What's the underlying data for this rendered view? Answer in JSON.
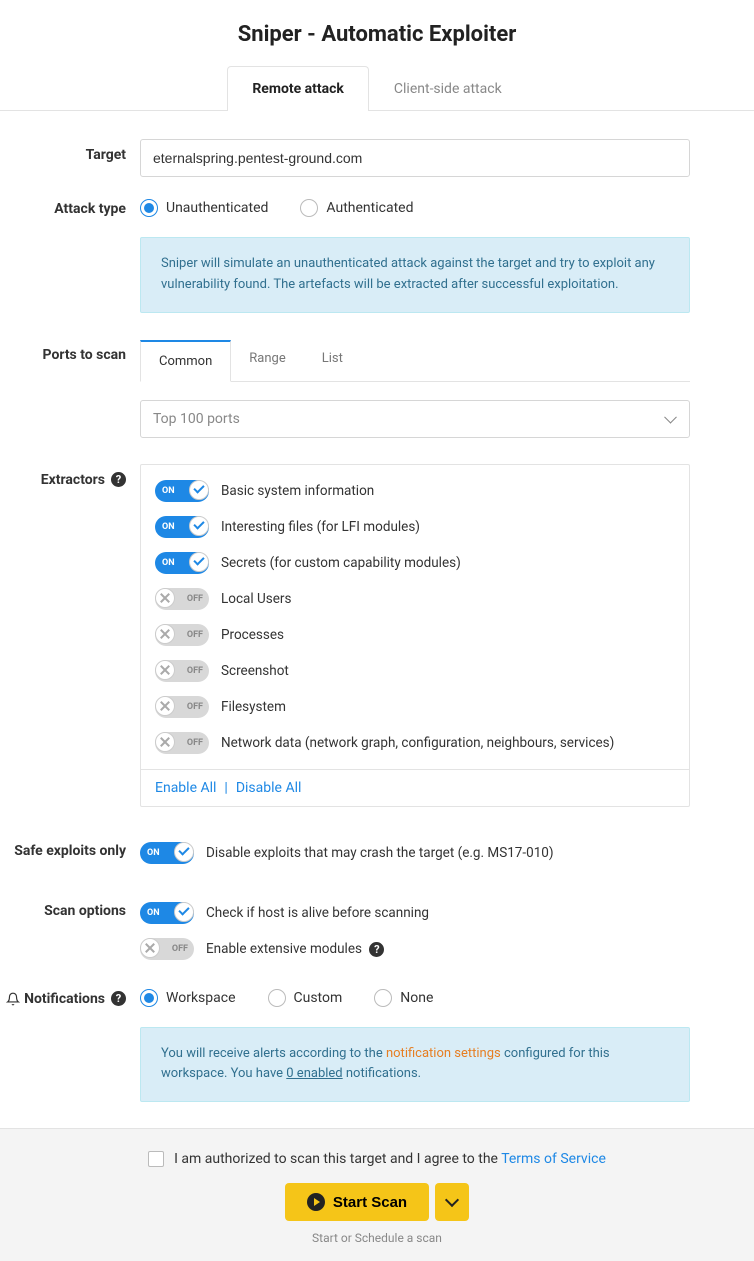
{
  "title": "Sniper - Automatic Exploiter",
  "tabs": {
    "remote": "Remote attack",
    "client": "Client-side attack"
  },
  "target": {
    "label": "Target",
    "value": "eternalspring.pentest-ground.com"
  },
  "attackType": {
    "label": "Attack type",
    "unauth": "Unauthenticated",
    "auth": "Authenticated",
    "info": "Sniper will simulate an unauthenticated attack against the target and try to exploit any vulnerability found. The artefacts will be extracted after successful exploitation."
  },
  "ports": {
    "label": "Ports to scan",
    "tabs": {
      "common": "Common",
      "range": "Range",
      "list": "List"
    },
    "selected": "Top 100 ports"
  },
  "extractors": {
    "label": "Extractors",
    "items": [
      {
        "on": true,
        "text": "Basic system information"
      },
      {
        "on": true,
        "text": "Interesting files (for LFI modules)"
      },
      {
        "on": true,
        "text": "Secrets (for custom capability modules)"
      },
      {
        "on": false,
        "text": "Local Users"
      },
      {
        "on": false,
        "text": "Processes"
      },
      {
        "on": false,
        "text": "Screenshot"
      },
      {
        "on": false,
        "text": "Filesystem"
      },
      {
        "on": false,
        "text": "Network data (network graph, configuration, neighbours, services)"
      }
    ],
    "enableAll": "Enable All",
    "disableAll": "Disable All",
    "on": "ON",
    "off": "OFF"
  },
  "safe": {
    "label": "Safe exploits only",
    "text": "Disable exploits that may crash the target (e.g. MS17-010)"
  },
  "scanOptions": {
    "label": "Scan options",
    "alive": "Check if host is alive before scanning",
    "extensive": "Enable extensive modules"
  },
  "notifications": {
    "label": "Notifications",
    "workspace": "Workspace",
    "custom": "Custom",
    "none": "None",
    "info1": "You will receive alerts according to the ",
    "link1": "notification settings",
    "info2": " configured for this workspace. You have ",
    "link2": "0 enabled",
    "info3": " notifications."
  },
  "footer": {
    "auth": "I am authorized to scan this target and I agree to the ",
    "tos": "Terms of Service",
    "start": "Start Scan",
    "hint": "Start or Schedule a scan"
  }
}
